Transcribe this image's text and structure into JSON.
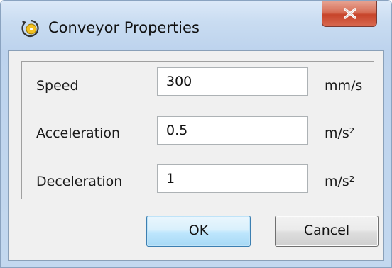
{
  "window": {
    "title": "Conveyor Properties",
    "app_icon": "conveyor-dial-icon",
    "close_icon": "close-icon",
    "close_glyph": "x"
  },
  "form": {
    "rows": [
      {
        "label": "Speed",
        "value": "300",
        "unit": "mm/s"
      },
      {
        "label": "Acceleration",
        "value": "0.5",
        "unit": "m/s²"
      },
      {
        "label": "Deceleration",
        "value": "1",
        "unit": "m/s²"
      }
    ]
  },
  "buttons": {
    "ok_label": "OK",
    "cancel_label": "Cancel"
  },
  "colors": {
    "ok_accent": "#3c7fb1",
    "close_red": "#c7442b"
  }
}
